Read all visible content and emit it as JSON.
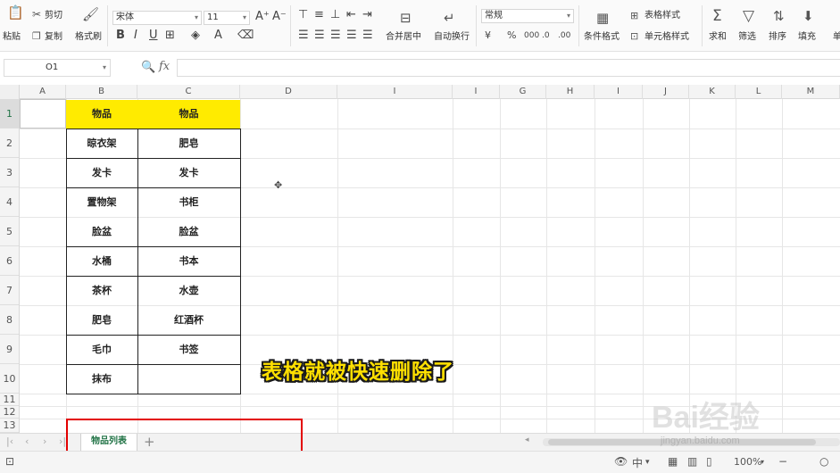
{
  "ribbon": {
    "paste_label": "粘贴",
    "cut_label": "剪切",
    "copy_label": "复制",
    "format_painter_label": "格式刷",
    "font_name": "宋体",
    "font_size": "11",
    "merge_center_label": "合并居中",
    "wrap_text_label": "自动换行",
    "number_format": "常规",
    "conditional_format_label": "条件格式",
    "table_style_label": "表格样式",
    "cell_style_label": "单元格样式",
    "sum_label": "求和",
    "filter_label": "筛选",
    "sort_label": "排序",
    "fill_label": "填充",
    "single_char": "单"
  },
  "formula_bar": {
    "name_box": "O1",
    "fx": "fx"
  },
  "grid": {
    "columns": [
      "A",
      "B",
      "C",
      "D",
      "I",
      "I",
      "G",
      "H",
      "I",
      "J",
      "K",
      "L",
      "M"
    ],
    "rows": [
      "1",
      "2",
      "3",
      "4",
      "5",
      "6",
      "7",
      "8",
      "9",
      "10",
      "11",
      "12",
      "13"
    ],
    "table": {
      "header_b": "物品",
      "header_c": "物品",
      "b": [
        "晾衣架",
        "发卡",
        "置物架",
        "脸盆",
        "水桶",
        "茶杯",
        "肥皂",
        "毛巾",
        "抹布"
      ],
      "c": [
        "肥皂",
        "发卡",
        "书柜",
        "脸盆",
        "书本",
        "水壶",
        "红酒杯",
        "书签",
        ""
      ]
    }
  },
  "caption": "表格就被快速删除了",
  "sheets": {
    "active_tab": "物品列表",
    "add_symbol": "+"
  },
  "status": {
    "input_mode": "中",
    "zoom": "100%",
    "zoom_out": "−"
  },
  "watermark": {
    "logo": "Bai经验",
    "url": "jingyan.baidu.com"
  },
  "colors": {
    "header_fill": "#ffeb00",
    "caption": "#ffe000",
    "highlight_box": "#e30000",
    "accent": "#217346"
  }
}
